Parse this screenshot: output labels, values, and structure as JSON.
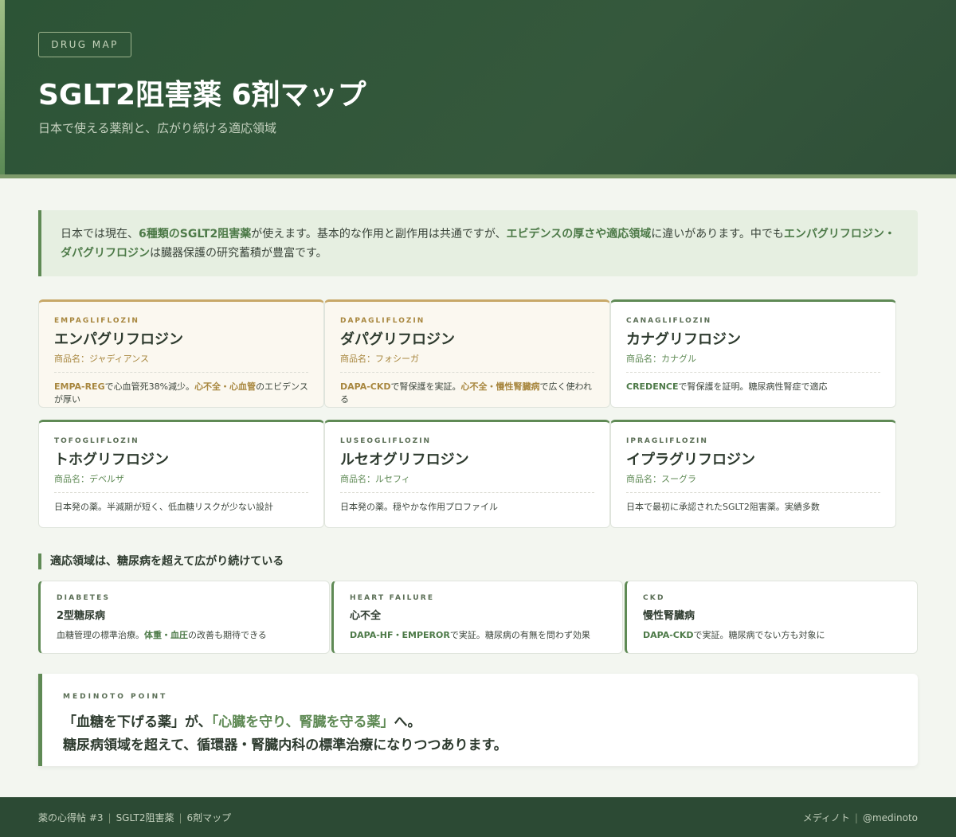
{
  "header": {
    "tag": "DRUG MAP",
    "title": "SGLT2阻害薬 6剤マップ",
    "subtitle": "日本で使える薬剤と、広がり続ける適応領域"
  },
  "intro": {
    "p1": "日本では現在、",
    "h1": "6種類のSGLT2阻害薬",
    "p2": "が使えます。基本的な作用と副作用は共通ですが、",
    "h2": "エビデンスの厚さや適応領域",
    "p3": "に違いがあります。中でも",
    "h3": "エンパグリフロジン・ダパグリフロジン",
    "p4": "は臓器保護の研究蓄積が豊富です。"
  },
  "drugs": [
    {
      "en": "EMPAGLIFLOZIN",
      "jp": "エンパグリフロジン",
      "brand": "商品名：ジャディアンス",
      "d1": "EMPA-REG",
      "d2": "で心血管死38%減少。",
      "d3": "心不全・心血管",
      "d4": "のエビデンスが厚い"
    },
    {
      "en": "DAPAGLIFLOZIN",
      "jp": "ダパグリフロジン",
      "brand": "商品名：フォシーガ",
      "d1": "DAPA-CKD",
      "d2": "で腎保護を実証。",
      "d3": "心不全・慢性腎臓病",
      "d4": "で広く使われる"
    },
    {
      "en": "CANAGLIFLOZIN",
      "jp": "カナグリフロジン",
      "brand": "商品名：カナグル",
      "d1": "CREDENCE",
      "d2": "で腎保護を証明。糖尿病性腎症で適応"
    },
    {
      "en": "TOFOGLIFLOZIN",
      "jp": "トホグリフロジン",
      "brand": "商品名：デベルザ",
      "d1": "日本発の薬。半減期が短く、低血糖リスクが少ない設計"
    },
    {
      "en": "LUSEOGLIFLOZIN",
      "jp": "ルセオグリフロジン",
      "brand": "商品名：ルセフィ",
      "d1": "日本発の薬。穏やかな作用プロファイル"
    },
    {
      "en": "IPRAGLIFLOZIN",
      "jp": "イプラグリフロジン",
      "brand": "商品名：スーグラ",
      "d1": "日本で最初に承認されたSGLT2阻害薬。実績多数"
    }
  ],
  "section": {
    "title": "適応領域は、糖尿病を超えて広がり続けている"
  },
  "indications": [
    {
      "en": "DIABETES",
      "jp": "2型糖尿病",
      "d1": "血糖管理の標準治療。",
      "d2": "体重・血圧",
      "d3": "の改善も期待できる"
    },
    {
      "en": "HEART FAILURE",
      "jp": "心不全",
      "d1": "DAPA-HF・EMPEROR",
      "d2": "で実証。糖尿病の有無を問わず効果"
    },
    {
      "en": "CKD",
      "jp": "慢性腎臓病",
      "d1": "DAPA-CKD",
      "d2": "で実証。糖尿病でない方も対象に"
    }
  ],
  "point": {
    "en": "MEDINOTO POINT",
    "l1a": "「血糖を下げる薬」が、",
    "l1b": "「心臓を守り、腎臓を守る薬」",
    "l1c": "へ。",
    "l2": "糖尿病領域を超えて、循環器・腎臓内科の標準治療になりつつあります。"
  },
  "footer": {
    "left1": "薬の心得帖 #3",
    "left2": "SGLT2阻害薬",
    "left3": "6剤マップ",
    "right1": "メディノト",
    "right2": "@medinoto"
  }
}
